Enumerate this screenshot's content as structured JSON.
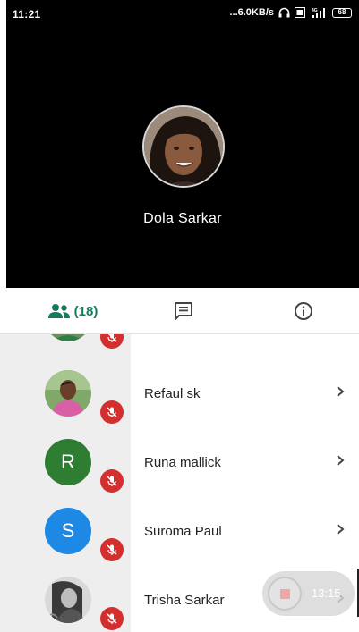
{
  "status_bar": {
    "time": "11:21",
    "speed": "...6.0KB/s",
    "network": "4G",
    "battery": "68"
  },
  "call": {
    "speaker_name": "Dola Sarkar",
    "speaker_avatar": "photo-avatar"
  },
  "tabs": {
    "people_count": "(18)",
    "people_icon": "people-icon",
    "chat_icon": "chat-icon",
    "info_icon": "info-icon",
    "accent_color": "#137a5e"
  },
  "participants": [
    {
      "name": "",
      "avatar": "photo",
      "muted": true
    },
    {
      "name": "Refaul sk",
      "avatar": "photo",
      "muted": true
    },
    {
      "name": "Runa mallick",
      "avatar_letter": "R",
      "avatar_color": "#2e7d32",
      "muted": true
    },
    {
      "name": "Suroma Paul",
      "avatar_letter": "S",
      "avatar_color": "#1e88e5",
      "muted": true
    },
    {
      "name": "Trisha Sarkar",
      "avatar": "photo",
      "muted": true
    }
  ],
  "recording": {
    "time": "13:15"
  },
  "colors": {
    "mute_badge": "#d32f2f",
    "video_bg": "#000000",
    "list_left_bg": "#eeeeee"
  }
}
